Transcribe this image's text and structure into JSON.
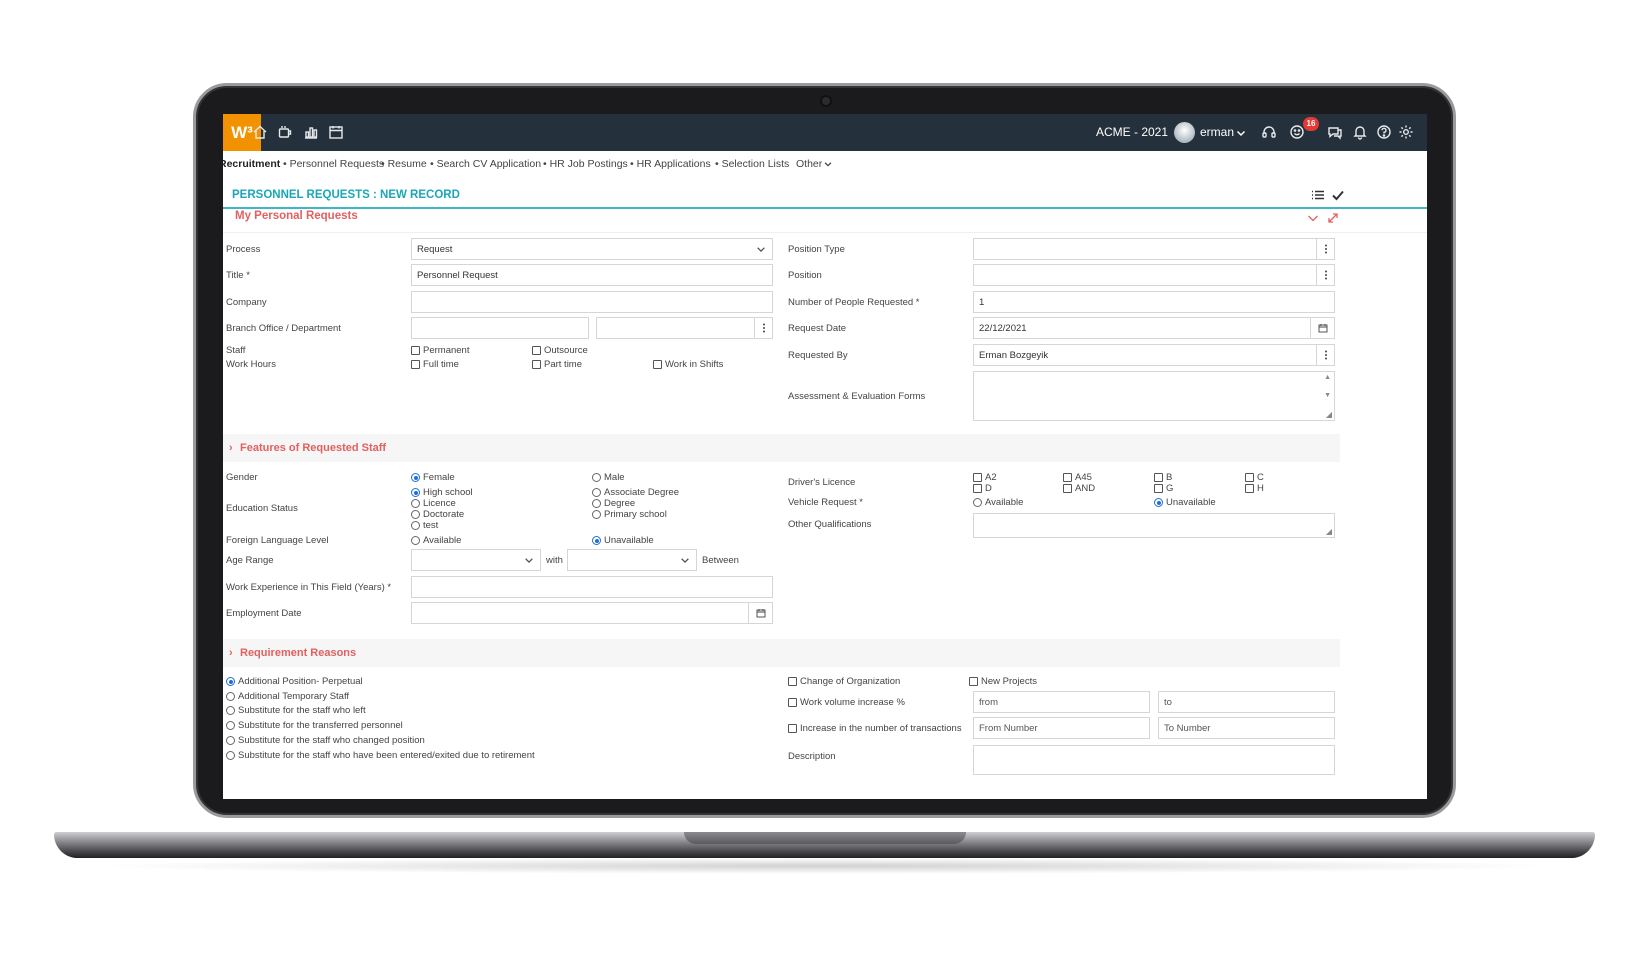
{
  "topbar": {
    "logo": "W³",
    "company": "ACME - 2021",
    "username": "erman",
    "notification_count": "16",
    "icons": [
      "home-icon",
      "coffee-icon",
      "chart-icon",
      "calendar-icon",
      "headset-icon",
      "smiley-icon",
      "chat-icon",
      "bell-icon",
      "help-icon",
      "gear-icon"
    ]
  },
  "subnav": {
    "items": [
      "Recruitment",
      "• Personnel Requests",
      "• Resume",
      "• Search CV Application",
      "• HR Job Postings",
      "• HR Applications",
      "• Selection Lists",
      "Other"
    ]
  },
  "page": {
    "title": "PERSONNEL REQUESTS : NEW RECORD"
  },
  "section": {
    "title": "My Personal Requests"
  },
  "form": {
    "process_label": "Process",
    "process_value": "Request",
    "title_label": "Title *",
    "title_value": "Personnel Request",
    "company_label": "Company",
    "branch_label": "Branch Office / Department",
    "staff_label": "Staff",
    "work_hours_label": "Work Hours",
    "permanent": "Permanent",
    "outsource": "Outsource",
    "full_time": "Full time",
    "part_time": "Part time",
    "work_in_shifts": "Work in Shifts",
    "position_type_label": "Position Type",
    "position_label": "Position",
    "people_label": "Number of People Requested *",
    "people_value": "1",
    "request_date_label": "Request Date",
    "request_date_value": "22/12/2021",
    "requested_by_label": "Requested By",
    "requested_by_value": "Erman Bozgeyik",
    "assessment_label": "Assessment & Evaluation Forms"
  },
  "features": {
    "title": "Features of Requested Staff",
    "gender_label": "Gender",
    "female": "Female",
    "male": "Male",
    "education_label": "Education Status",
    "edu": [
      "High school",
      "Associate Degree",
      "Licence",
      "Degree",
      "Doctorate",
      "Primary school",
      "test"
    ],
    "language_label": "Foreign Language Level",
    "available": "Available",
    "unavailable": "Unavailable",
    "age_label": "Age Range",
    "with": "with",
    "between": "Between",
    "experience_label": "Work Experience in This Field (Years) *",
    "employment_label": "Employment Date",
    "licence_label": "Driver's Licence",
    "licences": [
      "A2",
      "A45",
      "B",
      "C",
      "D",
      "AND",
      "G",
      "H"
    ],
    "vehicle_label": "Vehicle Request *",
    "other_label": "Other Qualifications"
  },
  "reasons": {
    "title": "Requirement Reasons",
    "items": [
      "Additional Position- Perpetual",
      "Additional Temporary Staff",
      "Substitute for the staff who left",
      "Substitute for the transferred personnel",
      "Substitute for the staff who changed position",
      "Substitute for the staff who have been entered/exited due to retirement"
    ],
    "change_org": "Change of Organization",
    "new_projects": "New Projects",
    "work_volume": "Work volume increase %",
    "from": "from",
    "to": "to",
    "transactions": "Increase in the number of transactions",
    "from_number": "From Number",
    "to_number": "To Number",
    "description_label": "Description"
  },
  "colors": {
    "topbar": "#24303b",
    "logo": "#f39200",
    "accent": "#1aa7b8",
    "section": "#e26060",
    "radio": "#1e6fd9"
  }
}
